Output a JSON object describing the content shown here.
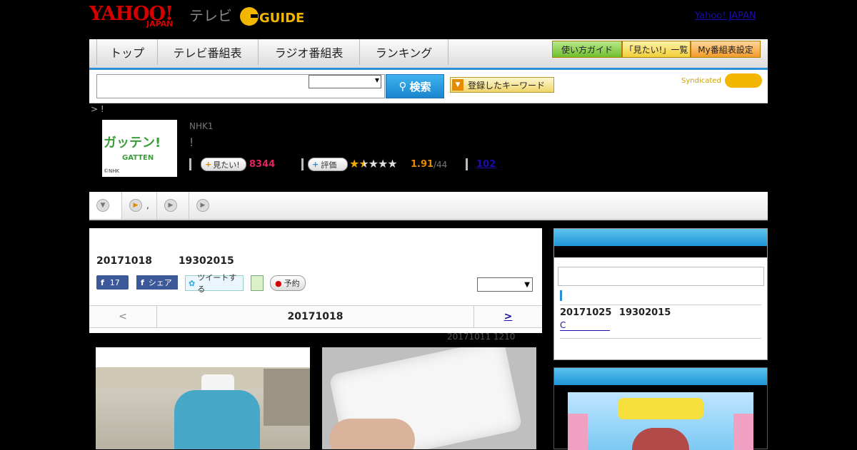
{
  "header": {
    "yahoo": "YAHOO!",
    "japan": "JAPAN",
    "tv": "テレビ",
    "gguide": "G GUIDE",
    "yj_link": "Yahoo! JAPAN"
  },
  "nav": {
    "tabs": [
      "トップ",
      "テレビ番組表",
      "ラジオ番組表",
      "ランキング"
    ],
    "guide_buttons": [
      "使い方ガイド",
      "「見たい!」一覧",
      "My番組表設定"
    ]
  },
  "search": {
    "button": "検索",
    "keyword_button": "登録したキーワード",
    "syndicated": "Syndicated"
  },
  "breadcrumb": "> !",
  "program": {
    "channel": "NHK1",
    "title": "!",
    "thumb_label": "ガッテン!",
    "thumb_sub": "GATTEN",
    "thumb_copy": "©NHK",
    "want_label": "見たい!",
    "want_count": "8344",
    "rate_label": "評価",
    "rating": "1.91",
    "rating_max": "/44",
    "review_count": "102",
    "stars_filled": 1.5,
    "stars_total": 5
  },
  "tabs": [
    ",",
    ""
  ],
  "main": {
    "date": "20171018",
    "time": "19302015",
    "like_count": "17",
    "share_label": "シェア",
    "tweet_label": "ツイートする",
    "reserve_label": "予約",
    "prev": "<",
    "current": "20171018",
    "next": ">",
    "note": "20171011  1210"
  },
  "sidebar": {
    "date": "20171025",
    "time": "19302015",
    "link": "C"
  },
  "colors": {
    "accent": "#2a8fd6",
    "want": "#e0245e",
    "rating": "#e68a00"
  }
}
